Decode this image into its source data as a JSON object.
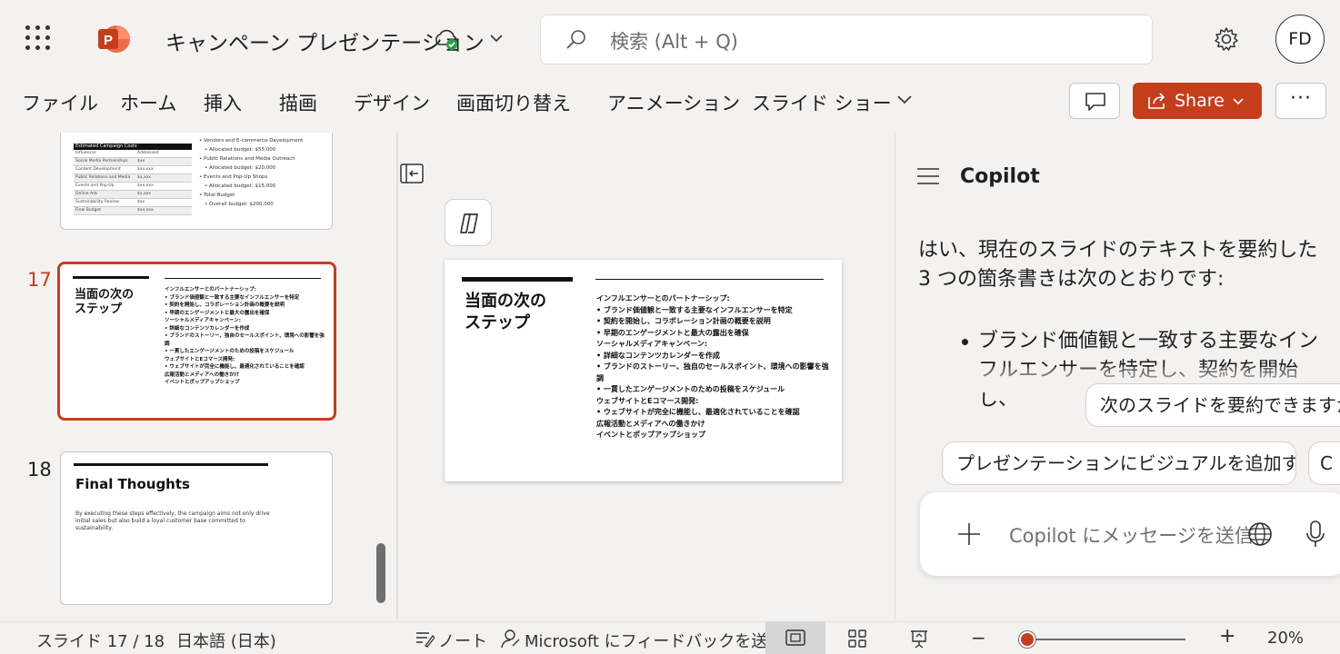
{
  "app": {
    "title": "キャンペーン プレゼンテーション",
    "accent": "#c43e1c"
  },
  "search": {
    "placeholder": "検索 (Alt + Q)"
  },
  "user": {
    "initials": "FD"
  },
  "ribbon": {
    "tabs": [
      "ファイル",
      "ホーム",
      "挿入",
      "描画",
      "デザイン",
      "画面切り替え",
      "アニメーション",
      "スライド ショー"
    ],
    "share_label": "Share",
    "more_label": "···"
  },
  "thumbnails": {
    "slide16": {
      "table_header": "Estimated Campaign Costs",
      "table_rows": [
        [
          "Influencer",
          "Addressed"
        ],
        [
          "Social Media Partnerships",
          "$xx"
        ],
        [
          "Content Development",
          "$xx,xxx"
        ],
        [
          "Public Relations and Media",
          "$x,xxx"
        ],
        [
          "Events and Pop-Up",
          "$xx,xxx"
        ],
        [
          "Online Ads",
          "$x,xxx"
        ],
        [
          "Sustainability Review",
          "$xx"
        ],
        [
          "Final Budget",
          "$xx,xxx"
        ]
      ],
      "bullets": [
        "Vendors and E-commerce Development",
        "Allocated budget: $55,000",
        "Public Relations and Media Outreach",
        "Allocated budget: $20,000",
        "Events and Pop-Up Shops",
        "Allocated budget: $15,000",
        "Total Budget",
        "Overall budget: $200,000"
      ]
    },
    "slide17": {
      "number": "17",
      "title": "当面の次の\nステップ"
    },
    "slide18": {
      "number": "18",
      "title": "Final Thoughts",
      "body": "By executing these steps effectively, the campaign aims not only drive initial sales but also build a loyal customer base committed to sustainability."
    }
  },
  "slide": {
    "title": "当面の次の\nステップ",
    "lines": [
      {
        "text": "インフルエンサーとのパートナーシップ:",
        "bold": true,
        "bullet": false
      },
      {
        "text": "ブランド価値観と一致する主要なインフルエンサーを特定",
        "bold": true,
        "bullet": true
      },
      {
        "text": "契約を開始し、コラボレーション計画の概要を説明",
        "bold": true,
        "bullet": true
      },
      {
        "text": "早期のエンゲージメントと最大の露出を確保",
        "bold": true,
        "bullet": true
      },
      {
        "text": "ソーシャルメディアキャンペーン:",
        "bold": true,
        "bullet": false
      },
      {
        "text": "詳細なコンテンツカレンダーを作成",
        "bold": true,
        "bullet": true
      },
      {
        "text": "ブランドのストーリー、独自のセールスポイント、環境への影響を強調",
        "bold": true,
        "bullet": true
      },
      {
        "text": "一貫したエンゲージメントのための投稿をスケジュール",
        "bold": true,
        "bullet": true
      },
      {
        "text": "ウェブサイトとEコマース開発:",
        "bold": true,
        "bullet": false
      },
      {
        "text": "ウェブサイトが完全に機能し、最適化されていることを確認",
        "bold": true,
        "bullet": true
      },
      {
        "text": "広報活動とメディアへの働きかけ",
        "bold": true,
        "bullet": false
      },
      {
        "text": "イベントとポップアップショップ",
        "bold": true,
        "bullet": false
      }
    ]
  },
  "copilot": {
    "title": "Copilot",
    "message": "はい、現在のスライドのテキストを要約した 3 つの箇条書きは次のとおりです:",
    "bullet1": "ブランド価値観と一致する主要なインフルエンサーを特定し、契約を開始し、",
    "suggestion1": "次のスライドを要約できますか",
    "suggestion2": "プレゼンテーションにビジュアルを追加する",
    "suggestion3": "C",
    "input_placeholder": "Copilot にメッセージを送信"
  },
  "status": {
    "slide_pos": "スライド 17 / 18",
    "language": "日本語 (日本)",
    "notes": "ノート",
    "feedback": "Microsoft にフィードバックを送信",
    "zoom_minus": "−",
    "zoom_plus": "+",
    "zoom": "20%",
    "zoom_fraction": 0.02
  }
}
